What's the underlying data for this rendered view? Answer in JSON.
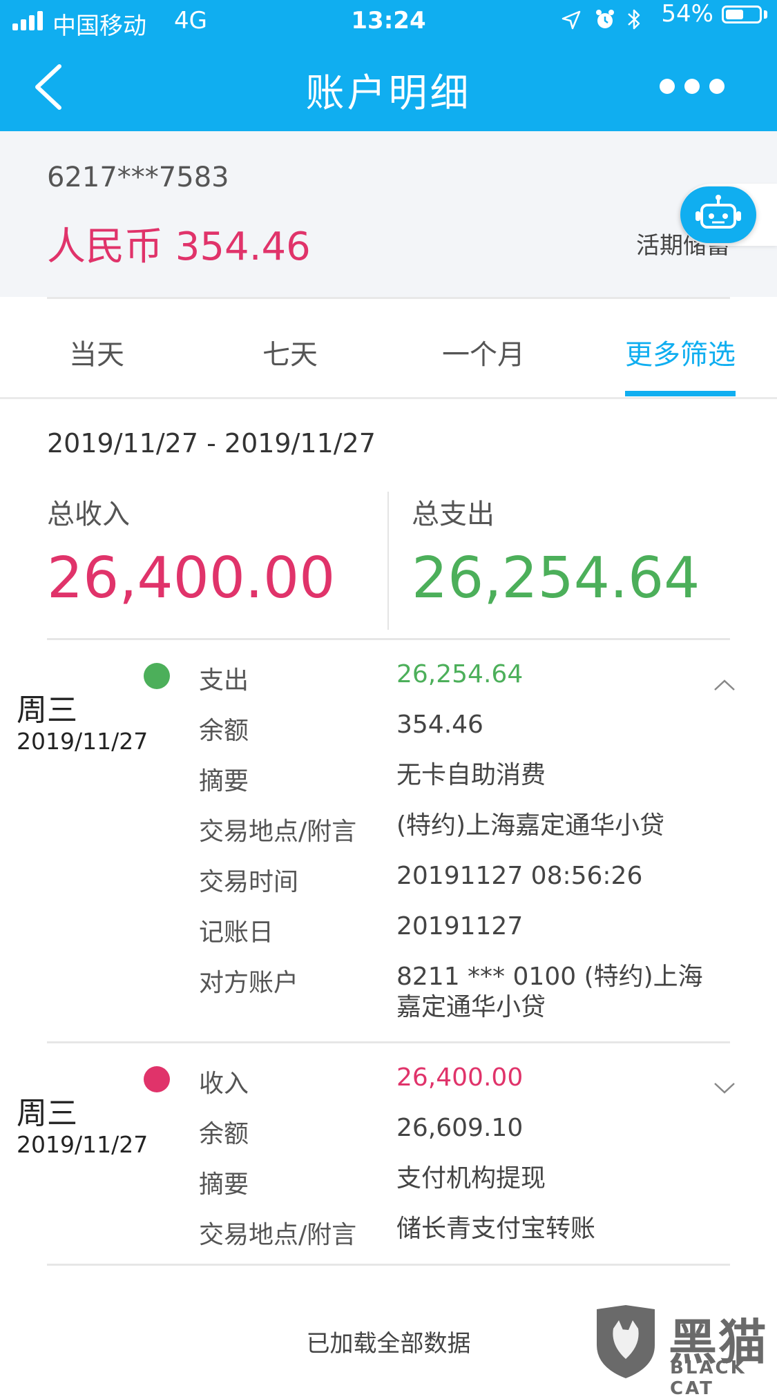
{
  "status_bar": {
    "carrier": "中国移动",
    "network": "4G",
    "time": "13:24",
    "battery": "54%",
    "battery_level": 0.54,
    "icons": [
      "signal-icon",
      "location-arrow-icon",
      "alarm-icon",
      "bluetooth-icon",
      "battery-icon"
    ]
  },
  "header": {
    "title": "账户明细",
    "back_icon": "chevron-left-icon",
    "more_icon": "more-dots-icon"
  },
  "account": {
    "number": "6217***7583",
    "balance": "人民币 354.46",
    "type": "活期储蓄",
    "assistant_icon": "robot-icon"
  },
  "tabs": [
    {
      "label": "当天",
      "active": false
    },
    {
      "label": "七天",
      "active": false
    },
    {
      "label": "一个月",
      "active": false
    },
    {
      "label": "更多筛选",
      "active": true
    }
  ],
  "summary": {
    "range": "2019/11/27 - 2019/11/27",
    "income_label": "总收入",
    "income_value": "26,400.00",
    "expense_label": "总支出",
    "expense_value": "26,254.64"
  },
  "transactions": [
    {
      "weekday": "周三",
      "date": "2019/11/27",
      "type_label": "支出",
      "amount": "26,254.64",
      "expanded": true,
      "rows": [
        {
          "label": "余额",
          "value": "354.46"
        },
        {
          "label": "摘要",
          "value": "无卡自助消费"
        },
        {
          "label": "交易地点/附言",
          "value": "(特约)上海嘉定通华小贷"
        },
        {
          "label": "交易时间",
          "value": "20191127 08:56:26"
        },
        {
          "label": "记账日",
          "value": "20191127"
        },
        {
          "label": "对方账户",
          "value": "8211 *** 0100 (特约)上海",
          "value_line2": "嘉定通华小贷"
        }
      ]
    },
    {
      "weekday": "周三",
      "date": "2019/11/27",
      "type_label": "收入",
      "amount": "26,400.00",
      "expanded": false,
      "rows": [
        {
          "label": "余额",
          "value": "26,609.10"
        },
        {
          "label": "摘要",
          "value": "支付机构提现"
        },
        {
          "label": "交易地点/附言",
          "value": "储长青支付宝转账"
        }
      ]
    }
  ],
  "footer": "已加载全部数据",
  "watermark": {
    "text": "黑猫",
    "sub": "BLACK CAT"
  },
  "colors": {
    "brand": "#10aef0",
    "income": "#e0336a",
    "expense": "#4caf5a"
  }
}
